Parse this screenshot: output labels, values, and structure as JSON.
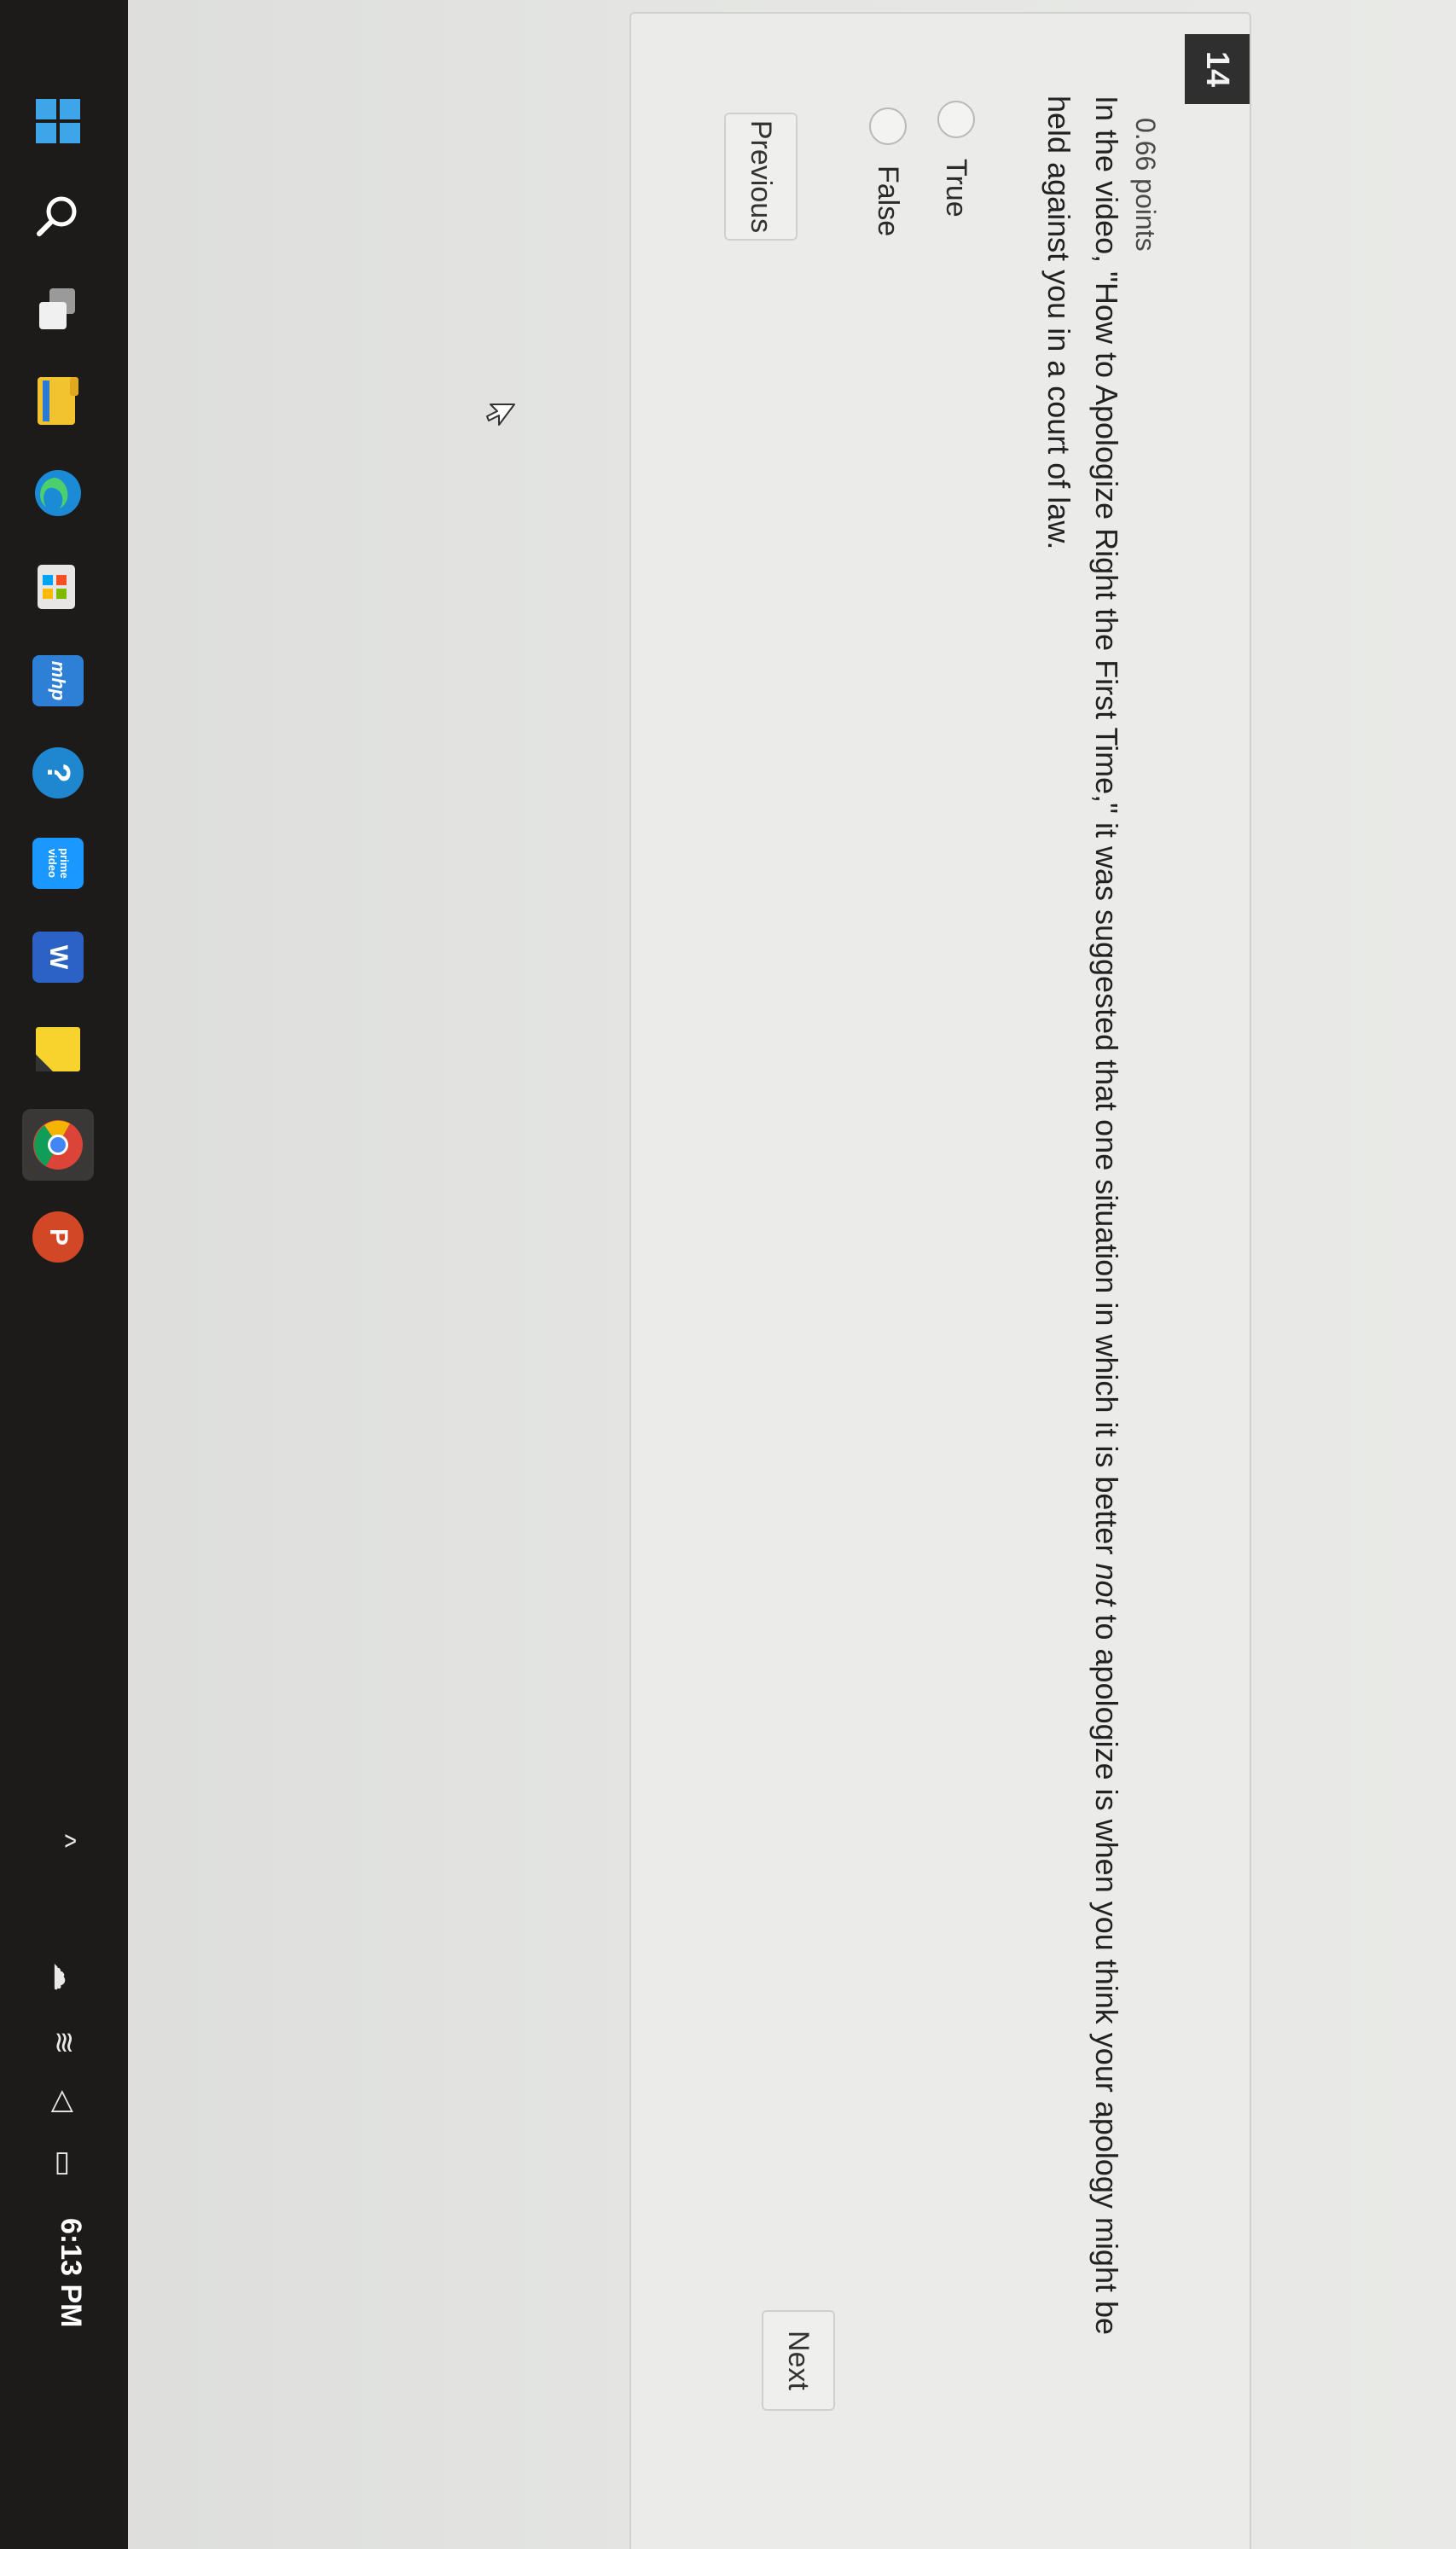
{
  "question": {
    "number": "14",
    "points": "0.66 points",
    "text_before": "In the video, \"How to Apologize Right the First Time,\" it was suggested that one situation in which it is better ",
    "text_emph": "not",
    "text_after": " to apologize is when you think your apology might be held against you in a court of law.",
    "options": [
      {
        "label": "True",
        "selected": false
      },
      {
        "label": "False",
        "selected": false
      }
    ]
  },
  "navigation": {
    "previous_label": "Previous",
    "next_label": "Next"
  },
  "taskbar": {
    "apps": [
      {
        "name": "windows-start",
        "glyph": "",
        "color": "#3a9bdc"
      },
      {
        "name": "search",
        "glyph": "",
        "color": "transparent"
      },
      {
        "name": "task-view",
        "glyph": "",
        "color": "#e0e0e0"
      },
      {
        "name": "file-explorer",
        "glyph": "",
        "color": "#f4c430"
      },
      {
        "name": "edge",
        "glyph": "",
        "color": "#1f8fd6"
      },
      {
        "name": "microsoft-store",
        "glyph": "",
        "color": "#e8e8e8"
      },
      {
        "name": "mcgraw-hill",
        "glyph": "mhp",
        "color": "#2e7fd6"
      },
      {
        "name": "help",
        "glyph": "?",
        "color": "#1f87d0"
      },
      {
        "name": "prime-video",
        "glyph": "prime video",
        "color": "#1a98ff"
      },
      {
        "name": "word",
        "glyph": "W",
        "color": "#2b62c4"
      },
      {
        "name": "sticky-notes",
        "glyph": "",
        "color": "#f6d32d"
      },
      {
        "name": "chrome",
        "glyph": "",
        "color": "#ffffff"
      },
      {
        "name": "powerpoint",
        "glyph": "P",
        "color": "#d24726"
      }
    ],
    "clock": "6:13 PM"
  }
}
